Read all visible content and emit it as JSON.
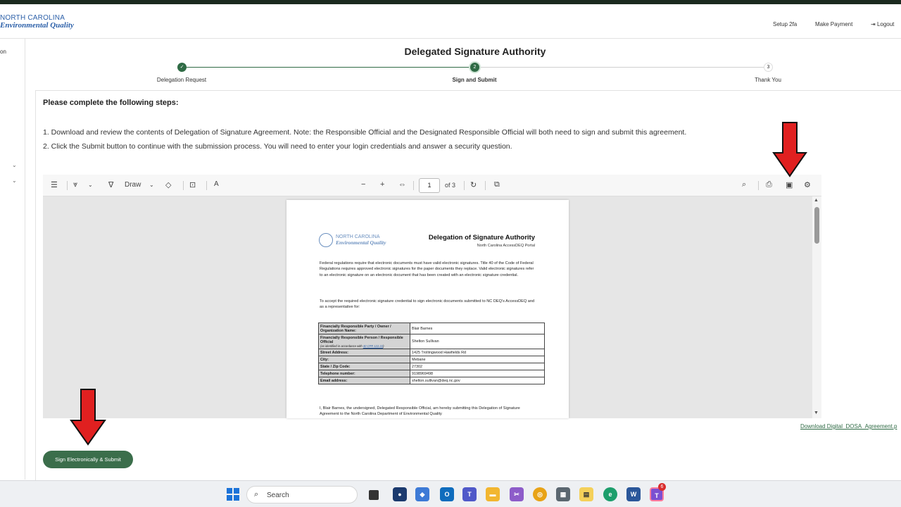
{
  "header": {
    "logo_line1": "NORTH CAROLINA",
    "logo_line2": "Environmental Quality",
    "links": [
      "Setup 2fa",
      "Make Payment",
      "Logout"
    ]
  },
  "sidebar": {
    "partial_text": "on"
  },
  "page": {
    "title": "Delegated Signature Authority"
  },
  "stepper": {
    "steps": [
      {
        "label": "Delegation Request",
        "marker": "✓",
        "state": "complete"
      },
      {
        "label": "Sign and Submit",
        "marker": "2",
        "state": "active"
      },
      {
        "label": "Thank You",
        "marker": "3",
        "state": "pending"
      }
    ]
  },
  "instructions": {
    "heading": "Please complete the following steps:",
    "step1": "1. Download and review the contents of Delegation of Signature Agreement.  Note: the Responsible Official and the Designated Responsible Official will both need to sign and submit this agreement.",
    "step2": "2. Click the Submit button to continue with the submission process. You will need to enter your login credentials and answer a security question."
  },
  "pdf_viewer": {
    "draw_label": "Draw",
    "page_number": "1",
    "page_total": "of 3",
    "document": {
      "logo_line1": "NORTH CAROLINA",
      "logo_line2": "Environmental Quality",
      "title": "Delegation of Signature Authority",
      "subtitle": "North Carolina AccessDEQ Portal",
      "para1": "Federal regulations require that electronic documents must have valid electronic signatures. Title 40 of the Code of Federal Regulations requires approved electronic signatures for the paper documents they replace.  Valid electronic signatures refer to an electronic signature on an electronic document that has been created with an electronic signature credential.",
      "para2": "To accept the required electronic signature credential to sign electronic documents submitted to NC DEQ's AccessDEQ and as a representative for:",
      "table": {
        "party_label": "Financially Responsible Party / Owner / Organization Name:",
        "party_value": "Blair Barnes",
        "person_label": "Financially Responsible Person / Responsible Official",
        "person_note": "(as identified in accordance with ",
        "person_note_link": "40 CFR 122.22",
        "person_note_end": ")",
        "person_value": "Shelton  Sullivan",
        "street_label": "Street Address:",
        "street_value": "1425 Trollingwood Hawfields Rd",
        "city_label": "City:",
        "city_value": "Mebane",
        "zip_label": "State / Zip Code:",
        "zip_value": "27302",
        "phone_label": "Telephone number:",
        "phone_value": "9198969498",
        "email_label": "Email address:",
        "email_value": "shelton.sullivan@deq.nc.gov"
      },
      "para3": "I, Blair Barnes, the undersigned, Delegated Responsible Official, am hereby submitting this Delegation of Signature Agreement to the North Carolina Department of Environmental Quality"
    }
  },
  "download_link": "Download Digital_DOSA_Agreement.p",
  "submit_button": "Sign Electronically & Submit",
  "taskbar": {
    "search_label": "Search",
    "teams_badge": "6"
  },
  "colors": {
    "brand_green": "#3b6e4b",
    "brand_blue": "#2b5fa8",
    "arrow_red": "#e02020"
  }
}
